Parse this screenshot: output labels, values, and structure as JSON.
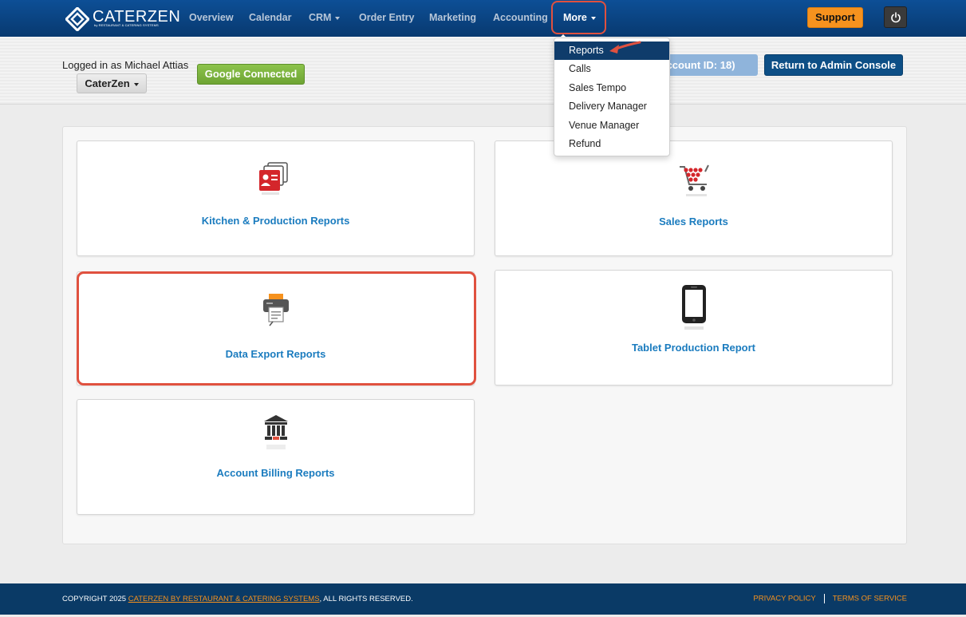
{
  "navbar": {
    "brand": "CATERZEN",
    "brand_sub": "by RESTAURANT & CATERING SYSTEMS",
    "items": [
      {
        "label": "Overview"
      },
      {
        "label": "Calendar"
      },
      {
        "label": "CRM"
      },
      {
        "label": "Order Entry"
      },
      {
        "label": "Marketing"
      },
      {
        "label": "Accounting"
      },
      {
        "label": "More"
      }
    ],
    "support_label": "Support",
    "power_icon": "power-icon"
  },
  "header": {
    "logged_in_text": "Logged in as Michael Attias",
    "account_name": "CaterZen",
    "google_label": "Google Connected",
    "account_id_label": "r Account ID: 18)",
    "admin_label": "Return to Admin Console"
  },
  "more_menu": {
    "items": [
      {
        "label": "Reports"
      },
      {
        "label": "Calls"
      },
      {
        "label": "Sales Tempo"
      },
      {
        "label": "Delivery Manager"
      },
      {
        "label": "Venue Manager"
      },
      {
        "label": "Refund"
      }
    ]
  },
  "reports": [
    {
      "title": "Kitchen & Production Reports",
      "icon": "kitchen-reports-icon"
    },
    {
      "title": "Sales Reports",
      "icon": "shopping-cart-icon"
    },
    {
      "title": "Data Export Reports",
      "icon": "printer-export-icon"
    },
    {
      "title": "Tablet Production Report",
      "icon": "tablet-icon"
    },
    {
      "title": "Account Billing Reports",
      "icon": "bank-icon"
    }
  ],
  "footer": {
    "copyright_prefix": "COPYRIGHT 2025 ",
    "copyright_link": "CATERZEN BY RESTAURANT & CATERING SYSTEMS",
    "copyright_suffix": ", ALL RIGHTS RESERVED.",
    "privacy": "PRIVACY POLICY",
    "terms": "TERMS OF SERVICE"
  },
  "colors": {
    "navbar": "#08396f",
    "accent_orange": "#f6921e",
    "link_blue": "#1b7cbf",
    "highlight_red": "#e0513f"
  }
}
